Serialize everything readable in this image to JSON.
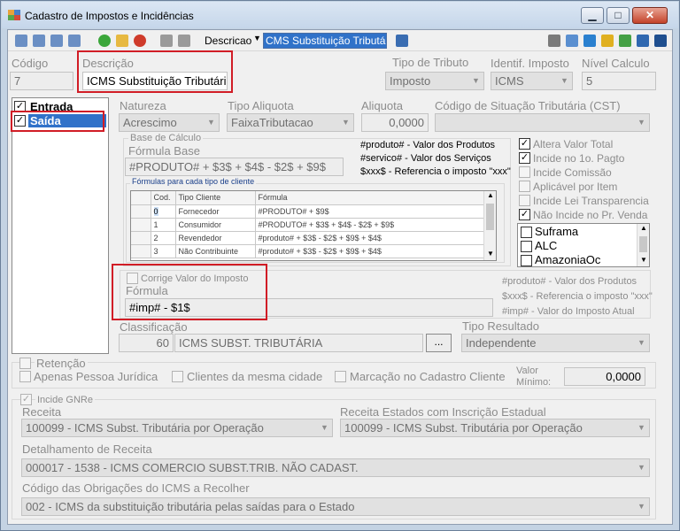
{
  "window": {
    "title": "Cadastro de Impostos e Incidências"
  },
  "toolbar": {
    "search_label": "Descricao",
    "search_value": "CMS Substituição Tributária"
  },
  "fields": {
    "codigo_label": "Código",
    "codigo_value": "7",
    "descricao_label": "Descrição",
    "descricao_value": "ICMS Substituição Tributária",
    "tipo_tributo_label": "Tipo de Tributo",
    "tipo_tributo_value": "Imposto",
    "identif_label": "Identif. Imposto",
    "identif_value": "ICMS",
    "nivel_label": "Nível Calculo",
    "nivel_value": "5"
  },
  "operations": {
    "items": [
      {
        "label": "Entrada",
        "checked": true,
        "selected": false
      },
      {
        "label": "Saída",
        "checked": true,
        "selected": true
      }
    ]
  },
  "config": {
    "natureza_label": "Natureza",
    "natureza_value": "Acrescimo",
    "tipo_aliquota_label": "Tipo Aliquota",
    "tipo_aliquota_value": "FaixaTributacao",
    "aliquota_label": "Aliquota",
    "aliquota_value": "0,0000",
    "cst_label": "Código de Situação Tributária (CST)",
    "cst_value": ""
  },
  "base": {
    "group_label": "Base de Cálculo",
    "formula_label": "Fórmula Base",
    "formula_value": "#PRODUTO# + $3$ + $4$ - $2$ + $9$",
    "legend": [
      "#produto# - Valor dos Produtos",
      "#servico# - Valor dos Serviços",
      "$xxx$ - Referencia o imposto \"xxx\""
    ],
    "formulas_group_label": "Fórmulas para cada tipo de cliente",
    "grid_headers": [
      "Cod.",
      "Tipo Cliente",
      "Fórmula"
    ],
    "grid_rows": [
      [
        "0",
        "Fornecedor",
        "#PRODUTO# + $9$"
      ],
      [
        "1",
        "Consumidor",
        "#PRODUTO# + $3$ + $4$ - $2$ + $9$"
      ],
      [
        "2",
        "Revendedor",
        "#produto# + $3$ - $2$ + $9$ + $4$"
      ],
      [
        "3",
        "Não Contribuinte",
        "#produto# + $3$ - $2$ + $9$ + $4$"
      ]
    ]
  },
  "options": [
    {
      "label": "Altera Valor Total",
      "checked": true
    },
    {
      "label": "Incide no 1o. Pagto",
      "checked": true
    },
    {
      "label": "Incide Comissão",
      "checked": false
    },
    {
      "label": "Aplicável por Item",
      "checked": false
    },
    {
      "label": "Incide Lei Transparencia",
      "checked": false
    },
    {
      "label": "Não Incide no Pr. Venda",
      "checked": true
    }
  ],
  "regions": [
    {
      "label": "Suframa",
      "checked": false
    },
    {
      "label": "ALC",
      "checked": false
    },
    {
      "label": "AmazoniaOc",
      "checked": false
    }
  ],
  "imposto": {
    "corrige_label": "Corrige Valor do Imposto",
    "formula_label": "Fórmula",
    "formula_value": "#imp# - $1$",
    "legend": [
      "#produto# - Valor dos Produtos",
      "$xxx$ - Referencia o imposto \"xxx\"",
      "#imp# - Valor do Imposto Atual"
    ]
  },
  "classificacao": {
    "label": "Classificação",
    "code": "60",
    "value": "ICMS SUBST. TRIBUTÁRIA",
    "button_label": "...",
    "tipo_resultado_label": "Tipo Resultado",
    "tipo_resultado_value": "Independente"
  },
  "retencao": {
    "label": "Retenção",
    "opt1": "Apenas Pessoa Jurídica",
    "opt2": "Clientes da mesma cidade",
    "opt3": "Marcação no Cadastro Cliente",
    "valor_label_1": "Valor",
    "valor_label_2": "Mínimo:",
    "valor_value": "0,0000"
  },
  "gnre": {
    "label": "Incide GNRe",
    "receita_label": "Receita",
    "receita_value": "100099 - ICMS Subst. Tributária por Operação",
    "receita_estados_label": "Receita Estados com Inscrição Estadual",
    "receita_estados_value": "100099 - ICMS Subst. Tributária por Operação",
    "detalhamento_label": "Detalhamento de Receita",
    "detalhamento_value": "000017 - 1538 - ICMS COMERCIO SUBST.TRIB. NÃO CADAST.",
    "obrigacoes_label": "Código das Obrigações do ICMS a Recolher",
    "obrigacoes_value": "002 - ICMS da substituição tributária pelas saídas para o Estado"
  }
}
